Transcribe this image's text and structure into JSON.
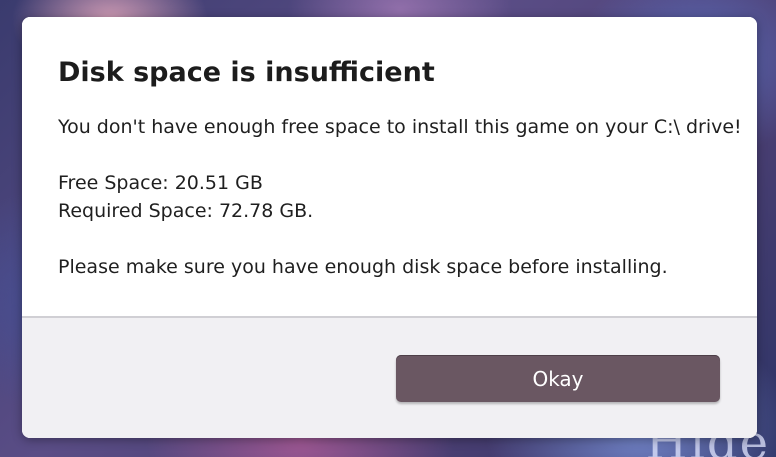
{
  "background": {
    "partial_text": "Hide"
  },
  "dialog": {
    "title": "Disk space is insufficient",
    "message": "You don't have enough free space to install this game on your C:\\ drive!",
    "free_space": "Free Space: 20.51 GB",
    "required_space": "Required Space: 72.78 GB.",
    "note": "Please make sure you have enough disk space before installing.",
    "okay_label": "Okay"
  },
  "colors": {
    "button_bg": "#6a5762",
    "footer_bg": "#f1f0f3",
    "dialog_bg": "#ffffff",
    "text": "#1f1f1f"
  }
}
